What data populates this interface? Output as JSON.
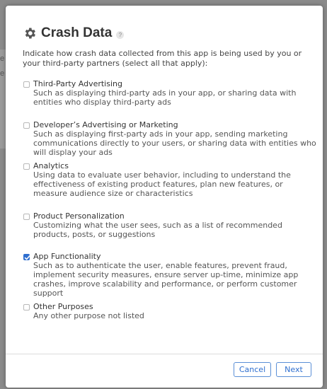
{
  "dialog": {
    "title": "Crash Data",
    "help_glyph": "?",
    "intro": "Indicate how crash data collected from this app is being used by you or your third-party partners (select all that apply):",
    "options": [
      {
        "label": "Third-Party Advertising",
        "description": "Such as displaying third-party ads in your app, or sharing data with entities who display third-party ads",
        "checked": false
      },
      {
        "label": "Developer’s Advertising or Marketing",
        "description": "Such as displaying first-party ads in your app, sending marketing communications directly to your users, or sharing data with entities who will display your ads",
        "checked": false
      },
      {
        "label": "Analytics",
        "description": "Using data to evaluate user behavior, including to understand the effectiveness of existing product features, plan new features, or measure audience size or characteristics",
        "checked": false
      },
      {
        "label": "Product Personalization",
        "description": "Customizing what the user sees, such as a list of recommended products, posts, or suggestions",
        "checked": false
      },
      {
        "label": "App Functionality",
        "description": "Such as to authenticate the user, enable features, prevent fraud, implement security measures, ensure server up-time, minimize app crashes, improve scalability and performance, or perform customer support",
        "checked": true
      },
      {
        "label": "Other Purposes",
        "description": "Any other purpose not listed",
        "checked": false
      }
    ],
    "buttons": {
      "cancel": "Cancel",
      "next": "Next"
    }
  },
  "backdrop": {
    "fragments": [
      "e",
      "e"
    ]
  },
  "colors": {
    "accent": "#2f6fcf",
    "title": "#333333",
    "overlay": "#8a8a8a"
  },
  "icons": {
    "title_icon": "gear-icon",
    "help_icon": "question-icon",
    "check_icon": "checkmark-icon"
  }
}
